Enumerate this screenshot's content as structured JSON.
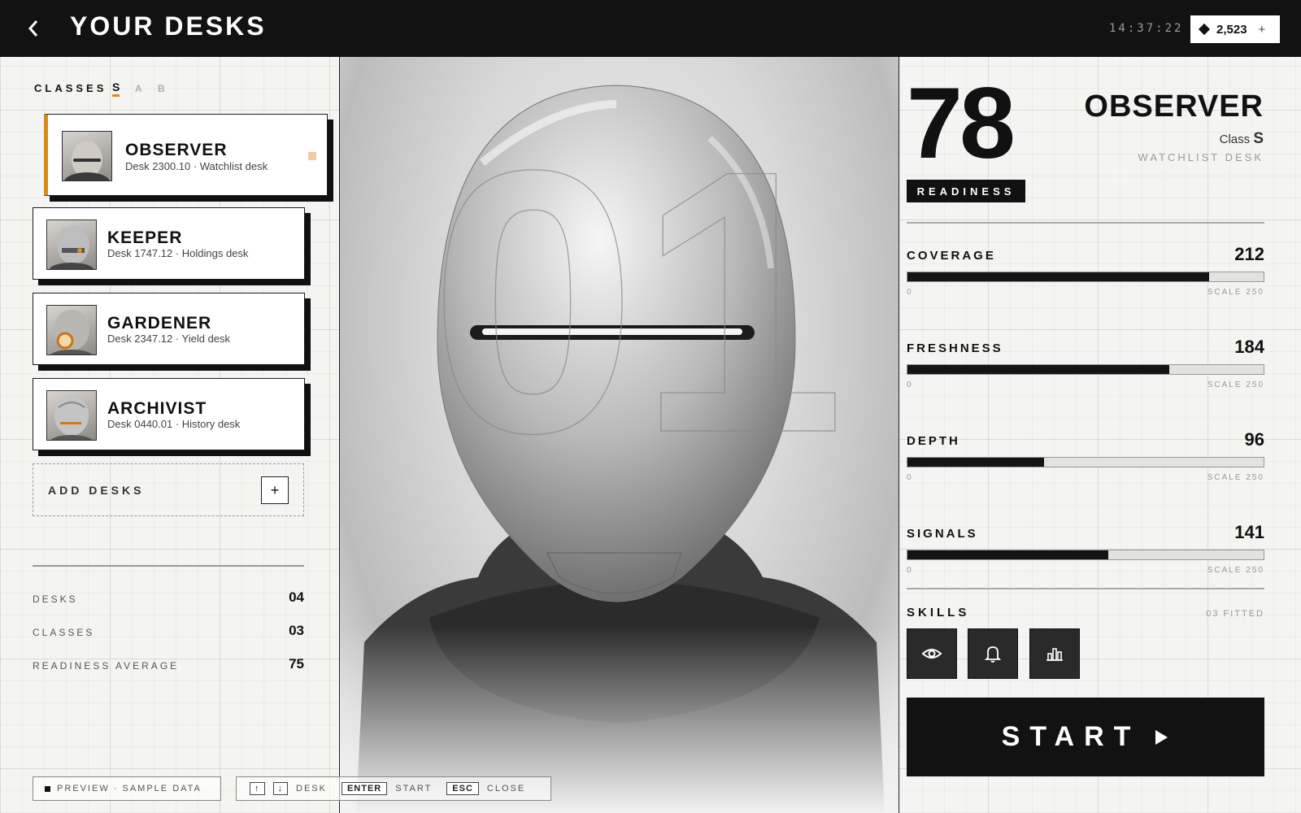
{
  "header": {
    "title": "YOUR DESKS",
    "clock": "14:37:22",
    "credits": "2,523",
    "credits_plus": "+"
  },
  "sidebar": {
    "classes_label": "CLASSES",
    "class_tabs": [
      "S",
      "A",
      "B"
    ],
    "desks": [
      {
        "name": "OBSERVER",
        "desk": "Desk 2300.10 · Watchlist desk",
        "selected": true
      },
      {
        "name": "KEEPER",
        "desk": "Desk 1747.12 · Holdings desk",
        "selected": false
      },
      {
        "name": "GARDENER",
        "desk": "Desk 2347.12 · Yield desk",
        "selected": false
      },
      {
        "name": "ARCHIVIST",
        "desk": "Desk 0440.01 · History desk",
        "selected": false
      }
    ],
    "add_label": "ADD DESKS",
    "add_plus": "+",
    "stats": [
      {
        "label": "DESKS",
        "value": "04"
      },
      {
        "label": "CLASSES",
        "value": "03"
      },
      {
        "label": "READINESS AVERAGE",
        "value": "75"
      }
    ]
  },
  "hero": {
    "watermark": "01"
  },
  "detail": {
    "readiness": "78",
    "readiness_label": "READINESS",
    "name": "OBSERVER",
    "class_prefix": "Class",
    "class_value": "S",
    "desk_type": "WATCHLIST DESK",
    "metrics": [
      {
        "label": "COVERAGE",
        "value": "212",
        "fraction": 0.848,
        "zero": "0",
        "scale": "SCALE 250"
      },
      {
        "label": "FRESHNESS",
        "value": "184",
        "fraction": 0.736,
        "zero": "0",
        "scale": "SCALE 250"
      },
      {
        "label": "DEPTH",
        "value": "96",
        "fraction": 0.384,
        "zero": "0",
        "scale": "SCALE 250"
      },
      {
        "label": "SIGNALS",
        "value": "141",
        "fraction": 0.564,
        "zero": "0",
        "scale": "SCALE 250"
      }
    ],
    "skills_label": "SKILLS",
    "skills_count": "03 FITTED",
    "skills": [
      "eye-icon",
      "bell-icon",
      "bar-chart-icon"
    ],
    "start_label": "START"
  },
  "footer": {
    "preview": "PREVIEW · SAMPLE DATA",
    "desk_hint": "DESK",
    "enter_key": "ENTER",
    "enter_hint": "START",
    "esc_key": "ESC",
    "esc_hint": "CLOSE"
  },
  "colors": {
    "accent": "#d98a1e",
    "topbar": "#121212",
    "background": "#f4f4f2"
  }
}
